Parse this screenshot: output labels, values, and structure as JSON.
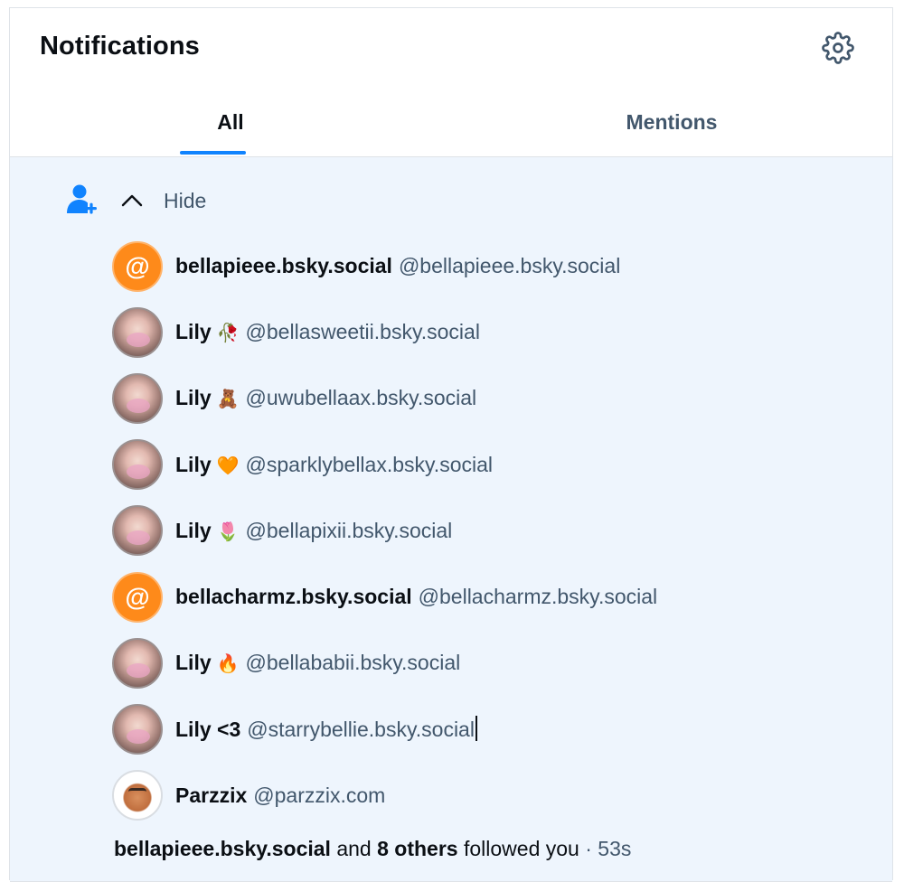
{
  "header": {
    "title": "Notifications",
    "settings_icon": "gear-icon"
  },
  "tabs": [
    {
      "label": "All",
      "active": true
    },
    {
      "label": "Mentions",
      "active": false
    }
  ],
  "colors": {
    "accent": "#1083fe",
    "feed_background": "#eef5fd",
    "muted_text": "#42576c",
    "default_avatar": "#fe8a1a"
  },
  "group": {
    "icon": "person-plus-icon",
    "toggle_icon": "chevron-up-icon",
    "toggle_label": "Hide",
    "users": [
      {
        "avatar": "at-avatar",
        "display_name": "bellapieee.bsky.social",
        "emoji": "",
        "handle": "@bellapieee.bsky.social"
      },
      {
        "avatar": "photo-avatar",
        "display_name": "Lily",
        "emoji": "🥀",
        "handle": "@bellasweetii.bsky.social"
      },
      {
        "avatar": "photo-avatar",
        "display_name": "Lily",
        "emoji": "🧸",
        "handle": "@uwubellaax.bsky.social"
      },
      {
        "avatar": "photo-avatar",
        "display_name": "Lily",
        "emoji": "🧡",
        "handle": "@sparklybellax.bsky.social"
      },
      {
        "avatar": "photo-avatar",
        "display_name": "Lily",
        "emoji": "🌷",
        "handle": "@bellapixii.bsky.social"
      },
      {
        "avatar": "at-avatar",
        "display_name": "bellacharmz.bsky.social",
        "emoji": "",
        "handle": "@bellacharmz.bsky.social"
      },
      {
        "avatar": "photo-avatar",
        "display_name": "Lily",
        "emoji": "🔥",
        "handle": "@bellababii.bsky.social"
      },
      {
        "avatar": "photo-avatar",
        "display_name": "Lily <3",
        "emoji": "",
        "handle": "@starrybellie.bsky.social"
      },
      {
        "avatar": "cartoon-avatar",
        "display_name": "Parzzix",
        "emoji": "",
        "handle": "@parzzix.com"
      }
    ],
    "summary": {
      "actor": "bellapieee.bsky.social",
      "conjunction": "and",
      "others": "8 others",
      "action": "followed you",
      "separator": "·",
      "time": "53s"
    }
  }
}
